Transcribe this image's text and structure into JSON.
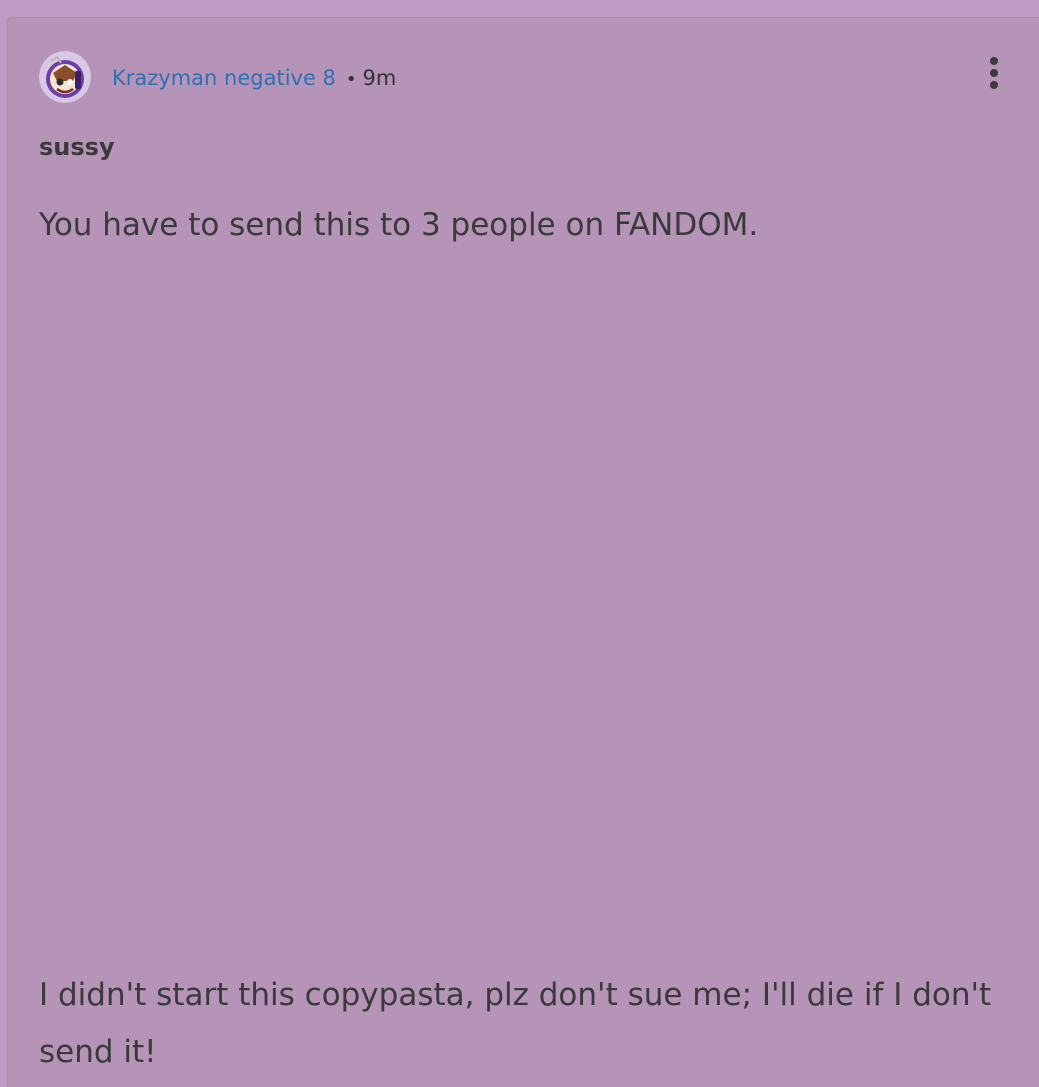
{
  "post": {
    "author": "Krazyman negative 8",
    "separator": "•",
    "time": "9m",
    "title": "sussy",
    "body_lines": [
      "You have to send this to 3 people on FANDOM.",
      "I didn't start this copypasta, plz don't sue me; I'll die if I don't send it!"
    ]
  },
  "icons": {
    "avatar": "avatar-image",
    "more": "more-options-icon"
  },
  "colors": {
    "page_background": "#c09bc3",
    "card_background": "#b594b8",
    "author_link": "#2f6fb3",
    "text": "#3a3a3a"
  }
}
